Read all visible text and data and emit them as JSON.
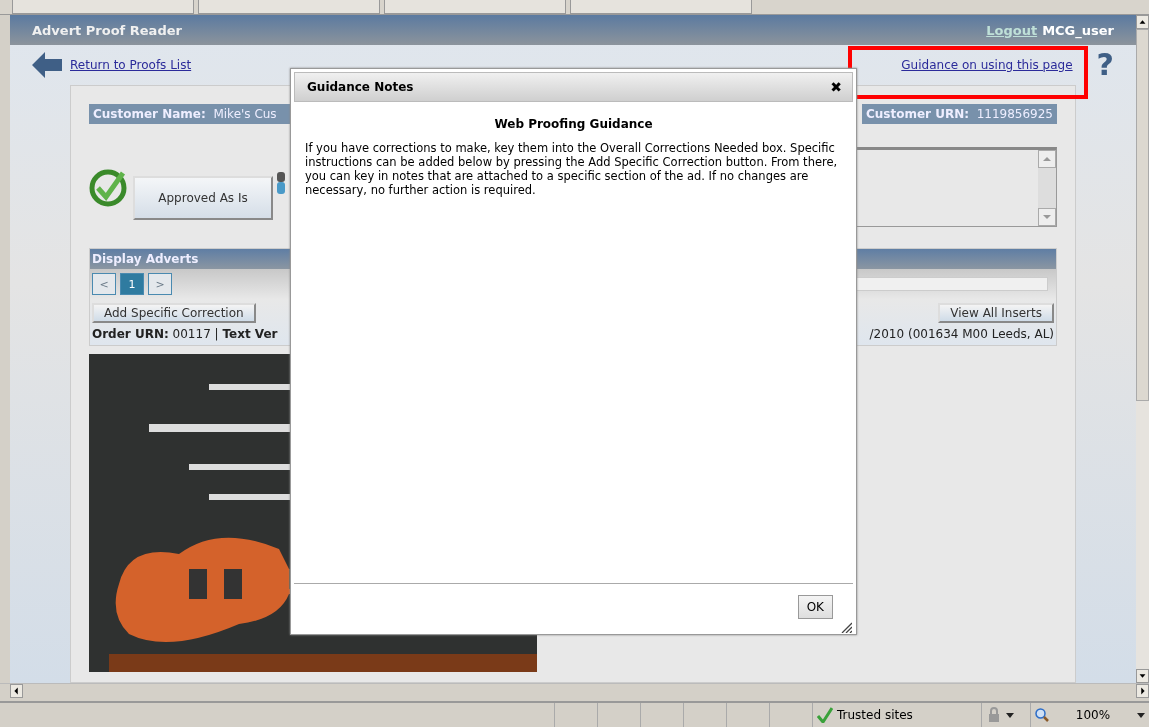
{
  "header": {
    "title": "Advert Proof Reader",
    "logout_link": "Logout",
    "username": "MCG_user"
  },
  "nav": {
    "back_link": "Return to Proofs List",
    "guidance_link": "Guidance on using this page",
    "guidance_help": "?",
    "highlighted": true
  },
  "customer": {
    "name_label": "Customer Name:",
    "name_value": "Mike's Cus",
    "urn_label": "Customer URN:",
    "urn_value": "1119856925"
  },
  "approve_button": "Approved As Is",
  "display_adverts": {
    "title": "Display Adverts",
    "pages": [
      {
        "label": "<",
        "disabled": true,
        "selected": false
      },
      {
        "label": "1",
        "disabled": false,
        "selected": true
      },
      {
        "label": ">",
        "disabled": true,
        "selected": false
      }
    ],
    "add_button": "Add Specific Correction",
    "view_button": "View All Inserts",
    "order_label": "Order URN:",
    "order_value": "00117 |",
    "text_label": "Text Ver",
    "order_tail": "/2010 (001634 M00 Leeds, AL)"
  },
  "dialog": {
    "title": "Guidance Notes",
    "close": "✖",
    "heading": "Web Proofing Guidance",
    "body": "If you have corrections to make, key them into the Overall Corrections Needed box. Specific instructions can be added below by pressing the Add Specific Correction button. From there, you can key in notes that are attached to a specific section of the ad. If no changes are necessary, no further action is required.",
    "ok_button": "OK"
  },
  "status_bar": {
    "zone": "Trusted sites",
    "zoom": "100%"
  }
}
